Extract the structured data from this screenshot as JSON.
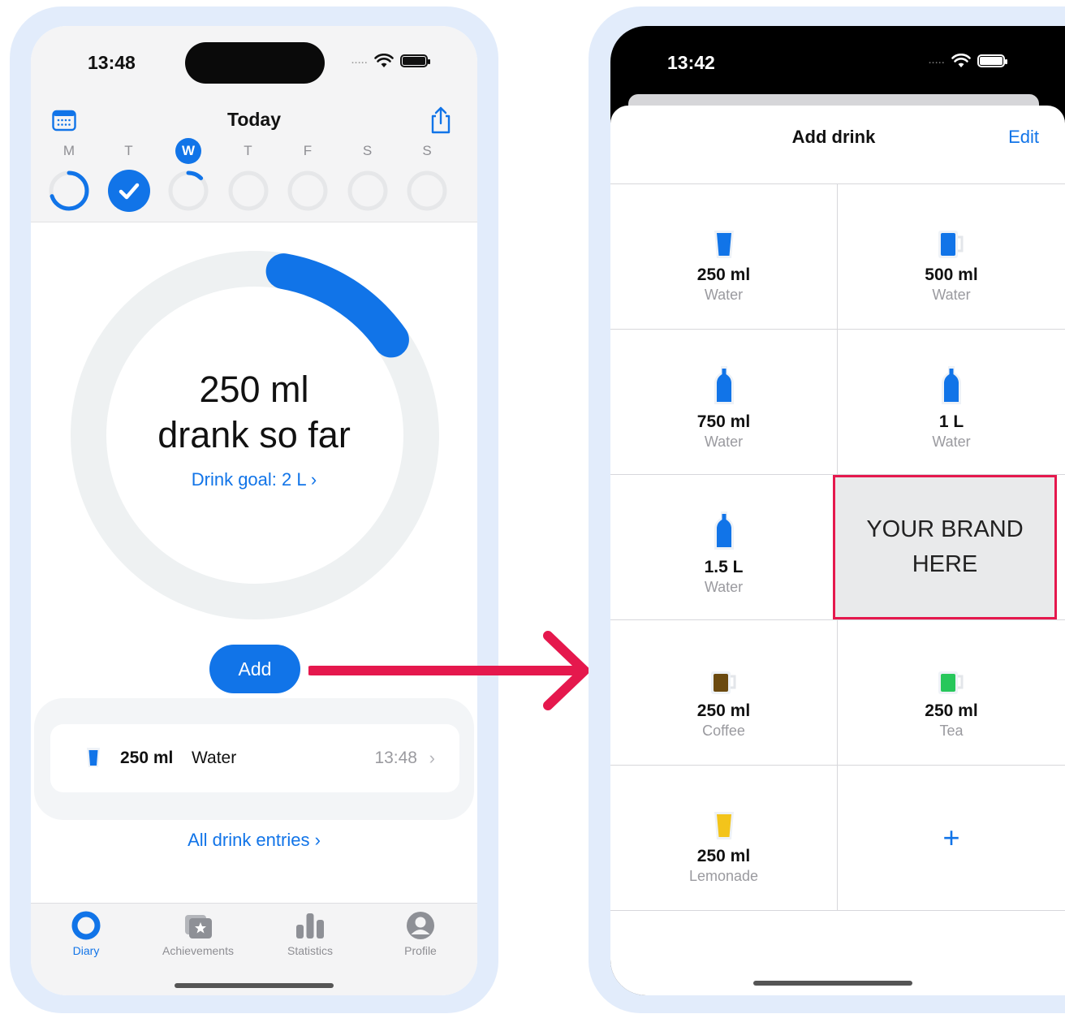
{
  "left": {
    "status_time": "13:48",
    "signal_dots": ".....",
    "header_title": "Today",
    "week": [
      {
        "letter": "M",
        "active": false,
        "progress": 0.7
      },
      {
        "letter": "T",
        "active": false,
        "progress": 1.0
      },
      {
        "letter": "W",
        "active": true,
        "progress": 0.125
      },
      {
        "letter": "T",
        "active": false,
        "progress": 0
      },
      {
        "letter": "F",
        "active": false,
        "progress": 0
      },
      {
        "letter": "S",
        "active": false,
        "progress": 0
      },
      {
        "letter": "S",
        "active": false,
        "progress": 0
      }
    ],
    "progress_fraction": 0.125,
    "amount_line1": "250 ml",
    "amount_line2": "drank so far",
    "goal_link": "Drink goal: 2 L ›",
    "add_label": "Add",
    "entry": {
      "amount": "250 ml",
      "type": "Water",
      "time": "13:48"
    },
    "all_entries": "All drink entries ›",
    "tabs": [
      "Diary",
      "Achievements",
      "Statistics",
      "Profile"
    ]
  },
  "right": {
    "status_time": "13:42",
    "signal_dots": ".....",
    "sheet_title": "Add drink",
    "edit_label": "Edit",
    "drinks": [
      {
        "amount": "250 ml",
        "type": "Water"
      },
      {
        "amount": "500 ml",
        "type": "Water"
      },
      {
        "amount": "750 ml",
        "type": "Water"
      },
      {
        "amount": "1 L",
        "type": "Water"
      },
      {
        "amount": "1.5 L",
        "type": "Water"
      },
      {
        "amount": "250 ml",
        "type": "Coffee"
      },
      {
        "amount": "250 ml",
        "type": "Tea"
      },
      {
        "amount": "250 ml",
        "type": "Lemonade"
      }
    ],
    "brand_line1": "YOUR BRAND",
    "brand_line2": "HERE",
    "add_custom": "+"
  },
  "colors": {
    "accent": "#1174e8",
    "arrow": "#e5184d",
    "frame": "#e2ecfb",
    "coffee": "#6b4a10",
    "tea": "#27c75b",
    "lemonade": "#f3c41b"
  }
}
